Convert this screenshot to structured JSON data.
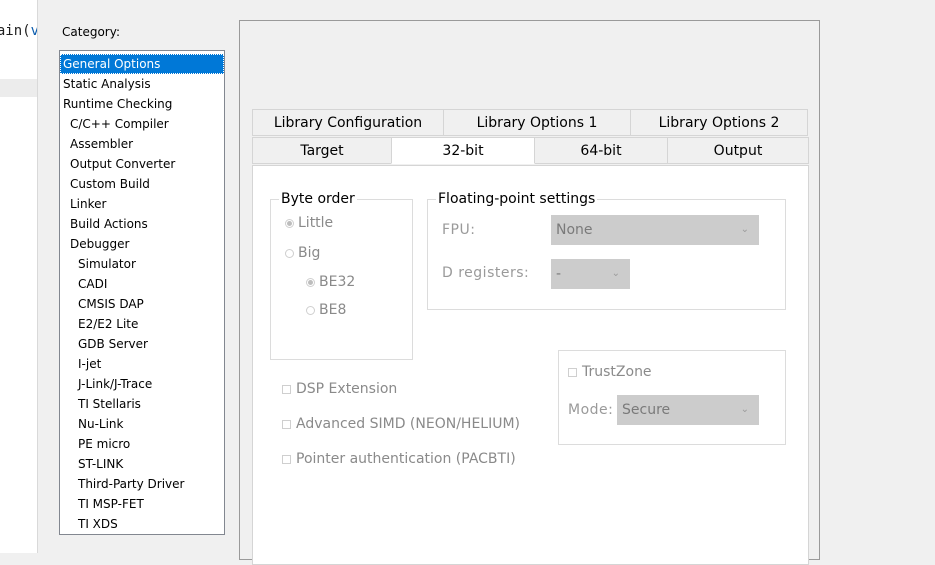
{
  "editor": {
    "code_fragment": "ain(",
    "code_paren": "v"
  },
  "category": {
    "label": "Category:",
    "items": [
      {
        "label": "General Options",
        "level": 0,
        "selected": true
      },
      {
        "label": "Static Analysis",
        "level": 0
      },
      {
        "label": "Runtime Checking",
        "level": 0
      },
      {
        "label": "C/C++ Compiler",
        "level": 1
      },
      {
        "label": "Assembler",
        "level": 1
      },
      {
        "label": "Output Converter",
        "level": 1
      },
      {
        "label": "Custom Build",
        "level": 1
      },
      {
        "label": "Linker",
        "level": 1
      },
      {
        "label": "Build Actions",
        "level": 1
      },
      {
        "label": "Debugger",
        "level": 1
      },
      {
        "label": "Simulator",
        "level": 2
      },
      {
        "label": "CADI",
        "level": 2
      },
      {
        "label": "CMSIS DAP",
        "level": 2
      },
      {
        "label": "E2/E2 Lite",
        "level": 2
      },
      {
        "label": "GDB Server",
        "level": 2
      },
      {
        "label": "I-jet",
        "level": 2
      },
      {
        "label": "J-Link/J-Trace",
        "level": 2
      },
      {
        "label": "TI Stellaris",
        "level": 2
      },
      {
        "label": "Nu-Link",
        "level": 2
      },
      {
        "label": "PE micro",
        "level": 2
      },
      {
        "label": "ST-LINK",
        "level": 2
      },
      {
        "label": "Third-Party Driver",
        "level": 2
      },
      {
        "label": "TI MSP-FET",
        "level": 2
      },
      {
        "label": "TI XDS",
        "level": 2
      }
    ]
  },
  "tabs": {
    "row1": [
      "Library Configuration",
      "Library Options 1",
      "Library Options 2"
    ],
    "row2": [
      "Target",
      "32-bit",
      "64-bit",
      "Output"
    ],
    "active": "32-bit"
  },
  "byte_order": {
    "legend": "Byte order",
    "little": "Little",
    "big": "Big",
    "be32": "BE32",
    "be8": "BE8",
    "selected": "Little",
    "sub_selected": "BE32"
  },
  "floating_point": {
    "legend": "Floating-point settings",
    "fpu_label": "FPU:",
    "fpu_value": "None",
    "dreg_label": "D registers:",
    "dreg_value": "-"
  },
  "extensions": {
    "dsp": "DSP Extension",
    "simd": "Advanced SIMD (NEON/HELIUM)",
    "pac": "Pointer authentication (PACBTI)"
  },
  "trustzone": {
    "label": "TrustZone",
    "mode_label": "Mode:",
    "mode_value": "Secure"
  },
  "icons": {
    "dropdown": "chevron-down-icon"
  }
}
